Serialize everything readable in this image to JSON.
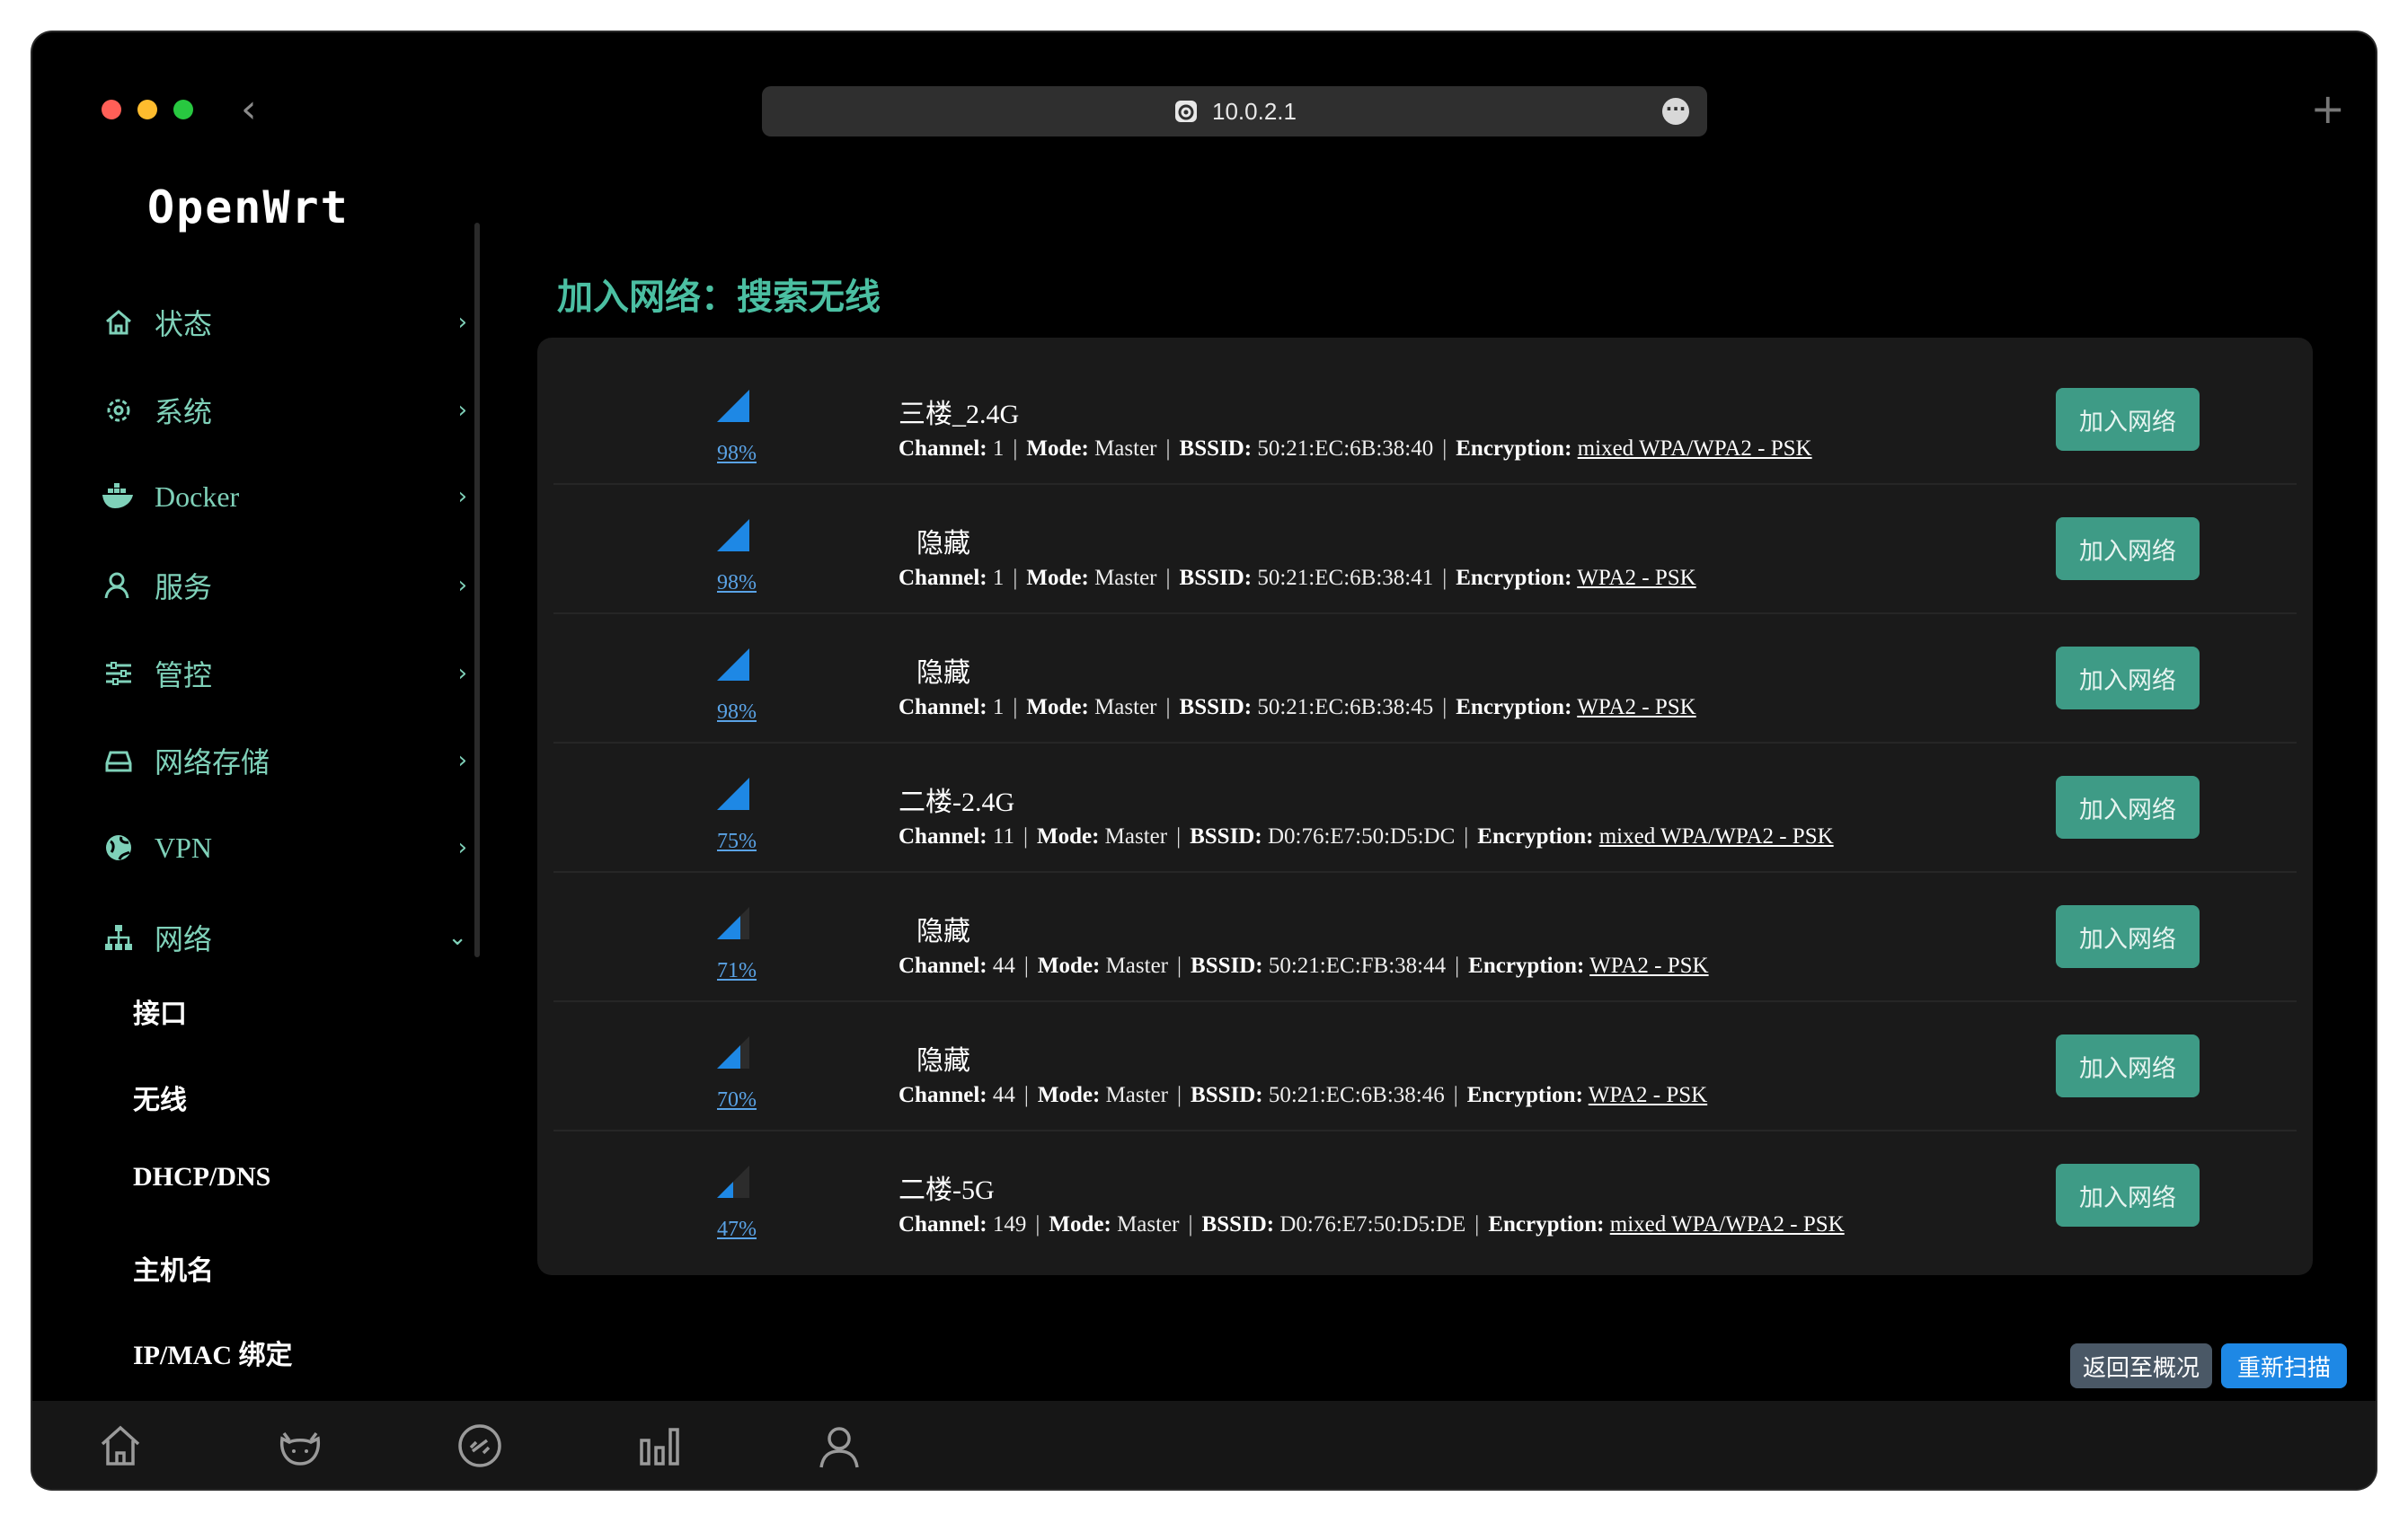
{
  "browser": {
    "url": "10.0.2.1"
  },
  "logo": "OpenWrt",
  "sidebar": {
    "items": [
      {
        "label": "状态",
        "icon": "home-icon"
      },
      {
        "label": "系统",
        "icon": "gear-icon"
      },
      {
        "label": "Docker",
        "icon": "docker-icon"
      },
      {
        "label": "服务",
        "icon": "user-icon"
      },
      {
        "label": "管控",
        "icon": "sliders-icon"
      },
      {
        "label": "网络存储",
        "icon": "storage-icon"
      },
      {
        "label": "VPN",
        "icon": "globe-icon"
      },
      {
        "label": "网络",
        "icon": "network-icon"
      }
    ],
    "subitems": [
      "接口",
      "无线",
      "DHCP/DNS",
      "主机名",
      "IP/MAC 绑定"
    ]
  },
  "page": {
    "title": "加入网络：搜索无线"
  },
  "labels": {
    "channel": "Channel:",
    "mode": "Mode:",
    "bssid": "BSSID:",
    "encryption": "Encryption:",
    "join": "加入网络"
  },
  "networks": [
    {
      "ssid": "三楼_2.4G",
      "signal": "98%",
      "channel": "1",
      "mode": "Master",
      "bssid": "50:21:EC:6B:38:40",
      "encryption": "mixed WPA/WPA2 - PSK"
    },
    {
      "ssid": "隐藏",
      "signal": "98%",
      "channel": "1",
      "mode": "Master",
      "bssid": "50:21:EC:6B:38:41",
      "encryption": "WPA2 - PSK"
    },
    {
      "ssid": "隐藏",
      "signal": "98%",
      "channel": "1",
      "mode": "Master",
      "bssid": "50:21:EC:6B:38:45",
      "encryption": "WPA2 - PSK"
    },
    {
      "ssid": "二楼-2.4G",
      "signal": "75%",
      "channel": "11",
      "mode": "Master",
      "bssid": "D0:76:E7:50:D5:DC",
      "encryption": "mixed WPA/WPA2 - PSK"
    },
    {
      "ssid": "隐藏",
      "signal": "71%",
      "channel": "44",
      "mode": "Master",
      "bssid": "50:21:EC:FB:38:44",
      "encryption": "WPA2 - PSK"
    },
    {
      "ssid": "隐藏",
      "signal": "70%",
      "channel": "44",
      "mode": "Master",
      "bssid": "50:21:EC:6B:38:46",
      "encryption": "WPA2 - PSK"
    },
    {
      "ssid": "二楼-5G",
      "signal": "47%",
      "channel": "149",
      "mode": "Master",
      "bssid": "D0:76:E7:50:D5:DE",
      "encryption": "mixed WPA/WPA2 - PSK"
    }
  ],
  "actions": {
    "back": "返回至概况",
    "rescan": "重新扫描"
  },
  "colors": {
    "accent": "#4bbfa2",
    "button": "#3e9b86",
    "signal": "#1e88e5"
  }
}
